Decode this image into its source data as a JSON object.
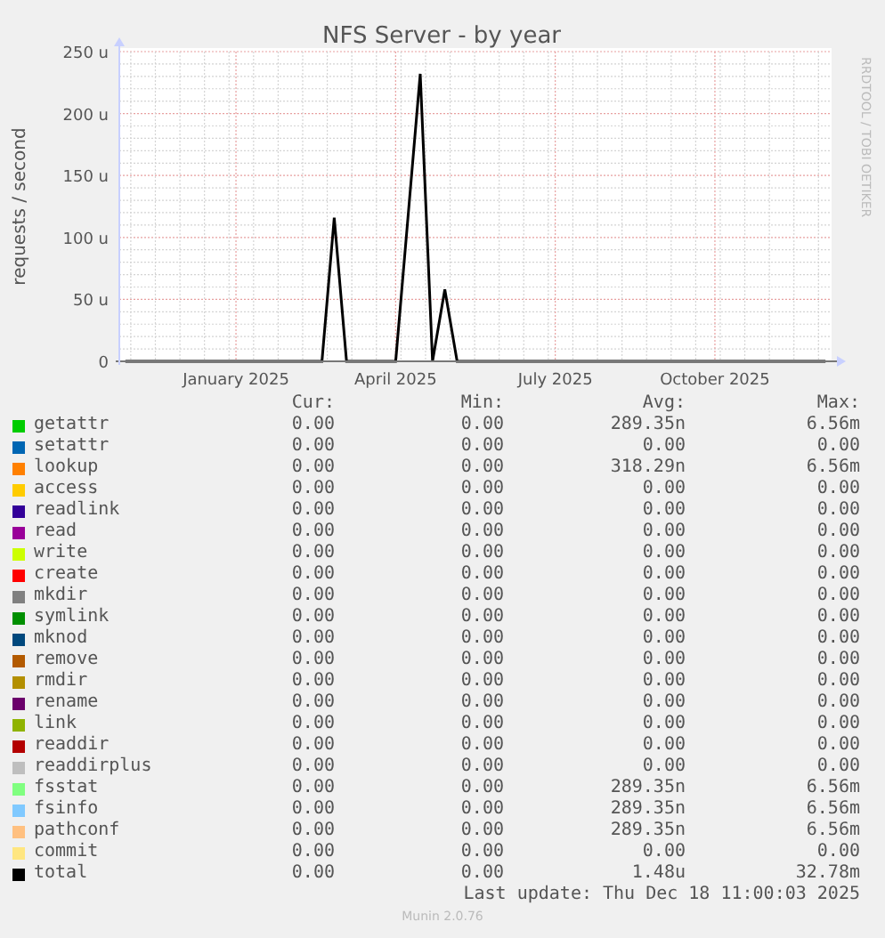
{
  "title": "NFS Server - by year",
  "credit": "RRDTOOL / TOBI OETIKER",
  "chart_data": {
    "type": "line",
    "grid": true,
    "ylabel": "requests / second",
    "ylim": [
      0,
      250
    ],
    "yticks": [
      {
        "value": 0,
        "label": "0"
      },
      {
        "value": 50,
        "label": "50 u"
      },
      {
        "value": 100,
        "label": "100 u"
      },
      {
        "value": 150,
        "label": "150 u"
      },
      {
        "value": 200,
        "label": "200 u"
      },
      {
        "value": 250,
        "label": "250 u"
      }
    ],
    "categories": [
      null,
      null,
      null,
      null,
      null,
      null,
      null,
      null,
      null,
      "January 2025",
      null,
      null,
      null,
      null,
      null,
      null,
      null,
      null,
      null,
      null,
      null,
      null,
      "April 2025",
      null,
      null,
      null,
      null,
      null,
      null,
      null,
      null,
      null,
      null,
      null,
      null,
      "July 2025",
      null,
      null,
      null,
      null,
      null,
      null,
      null,
      null,
      null,
      null,
      null,
      null,
      "October 2025",
      null,
      null,
      null,
      null,
      null,
      null,
      null,
      null,
      null
    ],
    "series": [
      {
        "color": "#000000",
        "values": [
          0,
          0,
          0,
          0,
          0,
          0,
          0,
          0,
          0,
          0,
          0,
          0,
          0,
          0,
          0,
          0,
          0,
          116,
          0,
          0,
          0,
          0,
          0,
          116,
          232,
          0,
          58,
          0,
          0,
          0,
          0,
          0,
          0,
          0,
          0,
          0,
          0,
          0,
          0,
          0,
          0,
          0,
          0,
          0,
          0,
          0,
          0,
          0,
          0,
          0,
          0,
          0,
          0,
          0,
          0,
          0,
          0,
          0
        ]
      }
    ]
  },
  "legend": {
    "columns": [
      "Cur:",
      "Min:",
      "Avg:",
      "Max:"
    ],
    "rows": [
      {
        "name": "getattr",
        "color": "#00cc00",
        "cur": "0.00",
        "min": "0.00",
        "avg": "289.35n",
        "max": "6.56m"
      },
      {
        "name": "setattr",
        "color": "#0066b3",
        "cur": "0.00",
        "min": "0.00",
        "avg": "0.00",
        "max": "0.00"
      },
      {
        "name": "lookup",
        "color": "#ff8000",
        "cur": "0.00",
        "min": "0.00",
        "avg": "318.29n",
        "max": "6.56m"
      },
      {
        "name": "access",
        "color": "#ffcc00",
        "cur": "0.00",
        "min": "0.00",
        "avg": "0.00",
        "max": "0.00"
      },
      {
        "name": "readlink",
        "color": "#330099",
        "cur": "0.00",
        "min": "0.00",
        "avg": "0.00",
        "max": "0.00"
      },
      {
        "name": "read",
        "color": "#990099",
        "cur": "0.00",
        "min": "0.00",
        "avg": "0.00",
        "max": "0.00"
      },
      {
        "name": "write",
        "color": "#ccff00",
        "cur": "0.00",
        "min": "0.00",
        "avg": "0.00",
        "max": "0.00"
      },
      {
        "name": "create",
        "color": "#ff0000",
        "cur": "0.00",
        "min": "0.00",
        "avg": "0.00",
        "max": "0.00"
      },
      {
        "name": "mkdir",
        "color": "#808080",
        "cur": "0.00",
        "min": "0.00",
        "avg": "0.00",
        "max": "0.00"
      },
      {
        "name": "symlink",
        "color": "#008f00",
        "cur": "0.00",
        "min": "0.00",
        "avg": "0.00",
        "max": "0.00"
      },
      {
        "name": "mknod",
        "color": "#00487d",
        "cur": "0.00",
        "min": "0.00",
        "avg": "0.00",
        "max": "0.00"
      },
      {
        "name": "remove",
        "color": "#b35a00",
        "cur": "0.00",
        "min": "0.00",
        "avg": "0.00",
        "max": "0.00"
      },
      {
        "name": "rmdir",
        "color": "#b38f00",
        "cur": "0.00",
        "min": "0.00",
        "avg": "0.00",
        "max": "0.00"
      },
      {
        "name": "rename",
        "color": "#6b006b",
        "cur": "0.00",
        "min": "0.00",
        "avg": "0.00",
        "max": "0.00"
      },
      {
        "name": "link",
        "color": "#8fb300",
        "cur": "0.00",
        "min": "0.00",
        "avg": "0.00",
        "max": "0.00"
      },
      {
        "name": "readdir",
        "color": "#b30000",
        "cur": "0.00",
        "min": "0.00",
        "avg": "0.00",
        "max": "0.00"
      },
      {
        "name": "readdirplus",
        "color": "#bebebe",
        "cur": "0.00",
        "min": "0.00",
        "avg": "0.00",
        "max": "0.00"
      },
      {
        "name": "fsstat",
        "color": "#80ff80",
        "cur": "0.00",
        "min": "0.00",
        "avg": "289.35n",
        "max": "6.56m"
      },
      {
        "name": "fsinfo",
        "color": "#80c9ff",
        "cur": "0.00",
        "min": "0.00",
        "avg": "289.35n",
        "max": "6.56m"
      },
      {
        "name": "pathconf",
        "color": "#ffc080",
        "cur": "0.00",
        "min": "0.00",
        "avg": "289.35n",
        "max": "6.56m"
      },
      {
        "name": "commit",
        "color": "#ffe680",
        "cur": "0.00",
        "min": "0.00",
        "avg": "0.00",
        "max": "0.00"
      },
      {
        "name": "total",
        "color": "#000000",
        "cur": "0.00",
        "min": "0.00",
        "avg": "1.48u",
        "max": "32.78m"
      }
    ]
  },
  "last_update": "Last update: Thu Dec 18 11:00:03 2025",
  "footer": "Munin 2.0.76"
}
